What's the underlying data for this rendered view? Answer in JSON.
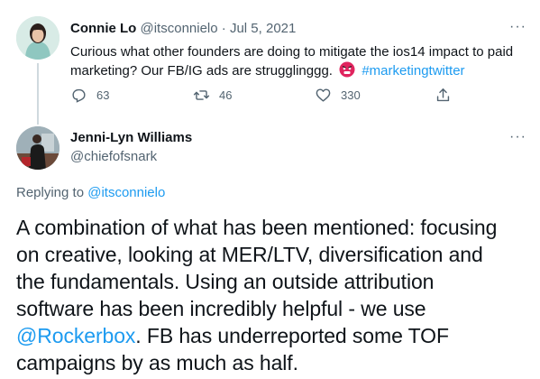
{
  "original_tweet": {
    "author_name": "Connie Lo",
    "author_handle": "@itsconnielo",
    "separator": "·",
    "date": "Jul 5, 2021",
    "text_line1": "Curious what other founders are doing to mitigate the ios14 impact to paid",
    "text_line2_prefix": "marketing? Our FB/IG ads are strugglinggg.",
    "emoji": "🤬",
    "hashtag": "#marketingtwitter",
    "actions": {
      "reply_count": "63",
      "retweet_count": "46",
      "like_count": "330"
    },
    "more_label": "···"
  },
  "reply_tweet": {
    "author_name": "Jenni-Lyn Williams",
    "author_handle": "@chiefofsnark",
    "more_label": "···",
    "replying_to_label": "Replying to",
    "replying_to_handle": "@itsconnielo",
    "text_line1": "A combination of what has been mentioned: focusing",
    "text_line2": "on creative, looking at MER/LTV, diversification and",
    "text_line3": "the fundamentals. Using an outside attribution",
    "text_line4": "software has been incredibly helpful - we use",
    "text_line5_mention": "@Rockerbox",
    "text_line5_rest": ". FB has underreported some TOF",
    "text_line6": "campaigns by as much as half."
  },
  "colors": {
    "accent": "#1d9bf0",
    "text": "#0f1419",
    "muted": "#536471",
    "thread_line": "#cfd9de"
  },
  "icons": [
    "reply-icon",
    "retweet-icon",
    "like-icon",
    "share-icon",
    "more-icon",
    "emoji-angry-icon"
  ]
}
